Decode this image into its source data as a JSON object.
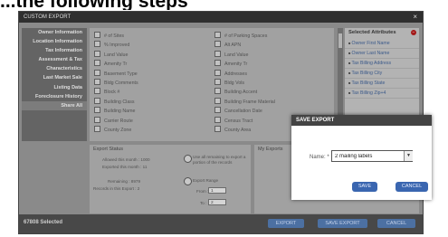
{
  "headline": "...the following steps",
  "dialog": {
    "title": "CUSTOM EXPORT",
    "close": "×"
  },
  "nav": [
    "Owner Information",
    "Location Information",
    "Tax Information",
    "Assessment & Tax",
    "Characteristics",
    "Last Market Sale",
    "Listing Data",
    "Foreclosure History",
    "Share All"
  ],
  "fields": {
    "col1": [
      "# of Sites",
      "% Improved",
      "Land Value",
      "Amenity Tr",
      "Basement Type",
      "Bldg Comments",
      "Block #",
      "Building Class",
      "Building Name",
      "Carrier Route",
      "County Zone"
    ],
    "col2": [
      "# of Parking Spaces",
      "Alt APN",
      "Land Value",
      "Amenity Tr",
      "Addresses",
      "Bldg Vols",
      "Building Accent",
      "Building Frame Material",
      "Cancellation Date",
      "Census Tract",
      "County Area"
    ]
  },
  "selected": {
    "title": "Selected Attributes",
    "items": [
      "Owner First Name",
      "Owner Last Name",
      "Tax Billing Address",
      "Tax Billing City",
      "Tax Billing State",
      "Tax Billing Zip+4"
    ]
  },
  "export_status": {
    "title": "Export Status",
    "allowed": "Allowed this month :  1000",
    "exported": "Exported this month :  11",
    "remaining": "Remaining :  8979",
    "records": "Records in this Export :  2",
    "option1": "Use all remaining to export a portion of the records",
    "option2": "Export Range",
    "from_label": "From :",
    "from_value": "1",
    "to_label": "To :",
    "to_value": "2"
  },
  "my_exports": {
    "title": "My Exports"
  },
  "footer": {
    "count": "67808 Selected",
    "export": "EXPORT",
    "save_export": "SAVE EXPORT",
    "cancel": "CANCEL"
  },
  "modal": {
    "title": "SAVE EXPORT",
    "name_label": "Name: *",
    "name_value": "2 mailing labels",
    "save": "SAVE",
    "cancel": "CANCEL"
  }
}
